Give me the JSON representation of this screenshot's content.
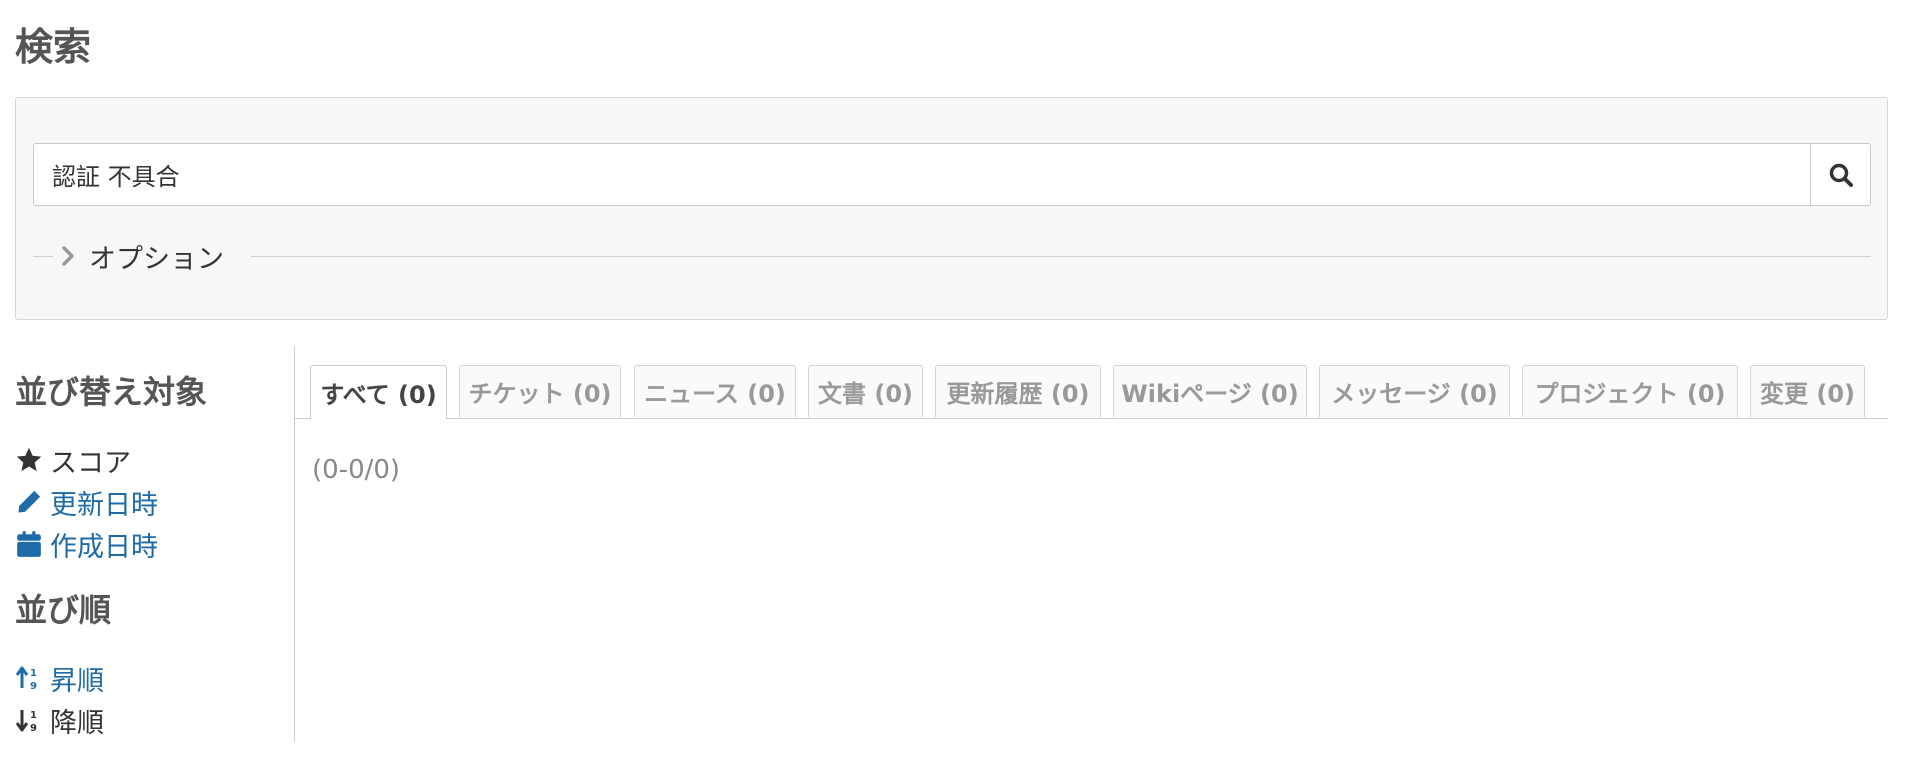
{
  "page": {
    "title": "検索"
  },
  "search": {
    "query": "認証 不具合",
    "options_label": "オプション"
  },
  "sidebar": {
    "sort_heading": "並び替え対象",
    "sort_fields": [
      {
        "label": "スコア",
        "icon": "star-icon"
      },
      {
        "label": "更新日時",
        "icon": "pencil-icon"
      },
      {
        "label": "作成日時",
        "icon": "calendar-icon"
      }
    ],
    "order_heading": "並び順",
    "order_options": [
      {
        "label": "昇順",
        "icon": "sort-ascending-icon"
      },
      {
        "label": "降順",
        "icon": "sort-descending-icon"
      }
    ]
  },
  "tabs": [
    {
      "label": "すべて (0)",
      "active": true
    },
    {
      "label": "チケット (0)"
    },
    {
      "label": "ニュース (0)"
    },
    {
      "label": "文書 (0)"
    },
    {
      "label": "更新履歴 (0)"
    },
    {
      "label": "Wikiページ (0)"
    },
    {
      "label": "メッセージ (0)"
    },
    {
      "label": "プロジェクト (0)"
    },
    {
      "label": "変更 (0)"
    }
  ],
  "results": {
    "count_text": "(0-0/0)"
  },
  "colors": {
    "link": "#1e6ba8",
    "heading": "#555555",
    "panel_bg": "#f6f7f9"
  }
}
